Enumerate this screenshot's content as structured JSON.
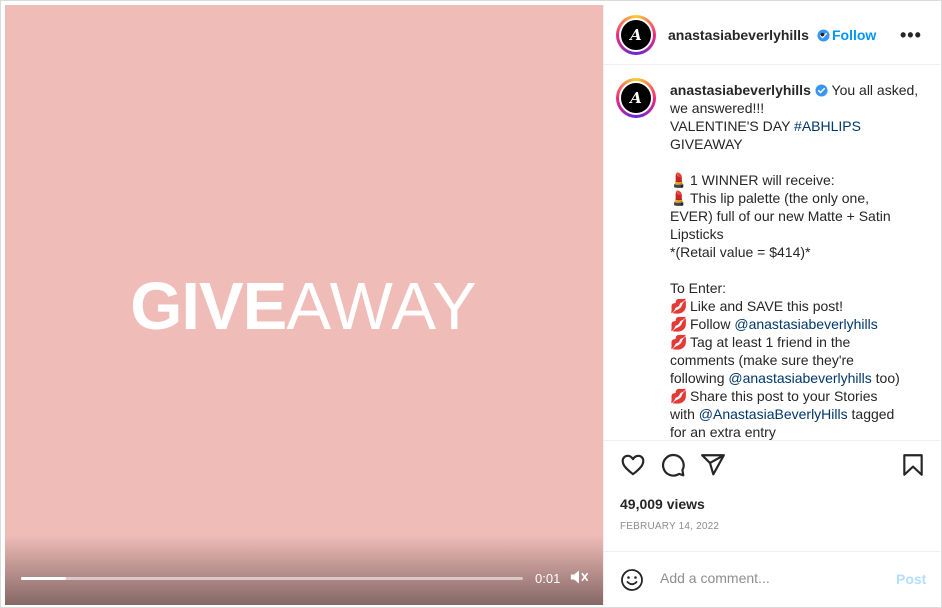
{
  "video": {
    "overlay_bold": "GIVE",
    "overlay_light": "AWAY",
    "background_color": "#f0bcb8",
    "progress": 0.09,
    "time": "0:01",
    "mute_icon": "speaker-muted-icon"
  },
  "header": {
    "avatar_letters": "A",
    "username": "anastasiabeverlyhills",
    "dot": "•",
    "follow_label": "Follow",
    "more_label": "•••"
  },
  "caption": {
    "username": "anastasiabeverlyhills",
    "line1": "You all asked,",
    "line2": "we answered!!!",
    "line3_text": "VALENTINE'S DAY ",
    "line3_tag": "#ABHLIPS",
    "line4": "GIVEAWAY",
    "winner": "1 WINNER will receive:",
    "palette1": "This lip palette (the only one,",
    "palette2": "EVER) full of our new Matte + Satin",
    "palette3": "Lipsticks",
    "retail": "*(Retail value = $414)*",
    "to_enter": "To Enter:",
    "step1": "Like and SAVE this post!",
    "step2_text": "Follow ",
    "step2_mention": "@anastasiabeverlyhills",
    "step3a": "Tag at least 1 friend in the",
    "step3b": "comments (make sure they're",
    "step3c_text": "following ",
    "step3c_mention": "@anastasiabeverlyhills",
    "step3c_end": " too)",
    "step4a": "Share this post to your Stories",
    "step4b_text": "with ",
    "step4b_mention": "@AnastasiaBeverlyHills",
    "step4b_end": " tagged",
    "step4c": "for an extra entry",
    "lipstick_emoji": "💄",
    "kiss_emoji": "💋"
  },
  "actions": {
    "like_icon": "heart-icon",
    "comment_icon": "comment-icon",
    "share_icon": "paper-plane-icon",
    "save_icon": "bookmark-icon"
  },
  "stats": {
    "views": "49,009 views",
    "date": "FEBRUARY 14, 2022"
  },
  "comment": {
    "placeholder": "Add a comment...",
    "post_label": "Post"
  },
  "colors": {
    "accent": "#0095f6",
    "link": "#00376b",
    "post_disabled": "#b2dffc"
  }
}
